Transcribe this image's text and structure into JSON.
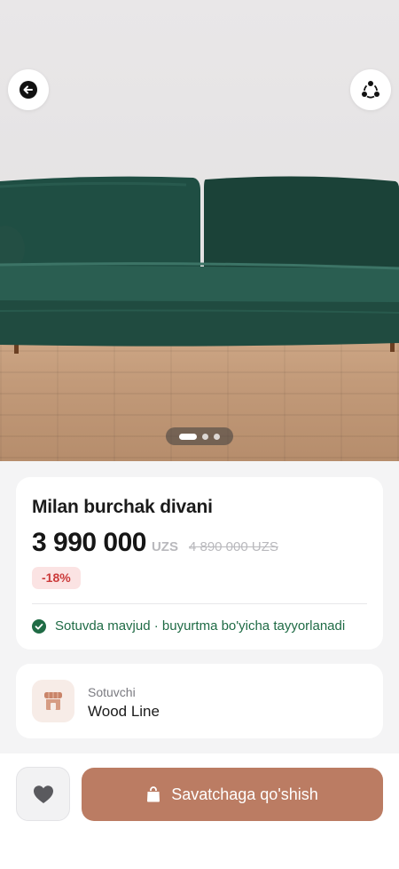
{
  "product": {
    "title": "Milan burchak divani",
    "price": "3 990 000",
    "currency": "UZS",
    "old_price": "4 890 000 UZS",
    "discount": "-18%",
    "stock_status": "Sotuvda mavjud · buyurtma bo'yicha tayyorlanadi",
    "gallery": {
      "images": 3,
      "active_index": 0
    }
  },
  "seller": {
    "caption": "Sotuvchi",
    "name": "Wood Line"
  },
  "actions": {
    "add_to_cart": "Savatchaga qo'shish"
  },
  "icons": {
    "back": "arrow-left-icon",
    "share": "share-icon",
    "stock": "check-circle-icon",
    "seller": "store-icon",
    "favorite": "heart-icon",
    "cart": "shopping-bag-icon"
  },
  "colors": {
    "accent": "#bb7c63",
    "success": "#1f6b45",
    "discount": "#cc3b3b",
    "discount_bg": "#fbe3e3"
  }
}
